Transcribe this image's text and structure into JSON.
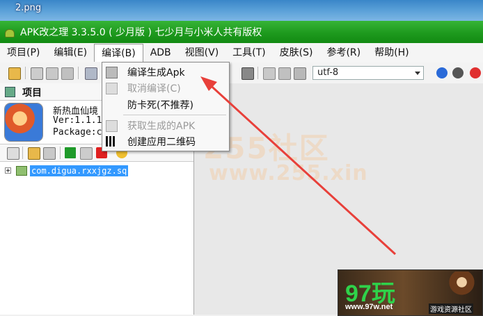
{
  "desktop": {
    "label": "2.png"
  },
  "window": {
    "title": "APK改之理 3.3.5.0 ( 少月版 ) 七少月与小米人共有版权"
  },
  "menu": [
    "项目(P)",
    "编辑(E)",
    "编译(B)",
    "ADB",
    "视图(V)",
    "工具(T)",
    "皮肤(S)",
    "参考(R)",
    "帮助(H)"
  ],
  "dropdown": {
    "items": [
      {
        "label": "编译生成Apk",
        "enabled": true
      },
      {
        "label": "取消编译(C)",
        "enabled": false
      },
      {
        "label": "防卡死(不推荐)",
        "enabled": true
      },
      {
        "label": "获取生成的APK",
        "enabled": false
      },
      {
        "label": "创建应用二维码",
        "enabled": true
      }
    ]
  },
  "toolbar": {
    "encoding": "utf-8"
  },
  "project_panel": {
    "title": "项目",
    "app_name": "新热血仙境",
    "app_version": "Ver:1.1.1",
    "app_package": "Package:c",
    "tree": {
      "item": "com.digua.rxxjgz.sq"
    }
  },
  "watermark": {
    "line1": "255社区",
    "line2": "www.255.xin"
  },
  "ad": {
    "logo": "97玩",
    "url": "www.97w.net",
    "tag": "游戏资源社区"
  },
  "colors": {
    "title_bar": "#1e9a1e",
    "selection": "#3399ff",
    "arrow": "#e8403a"
  }
}
